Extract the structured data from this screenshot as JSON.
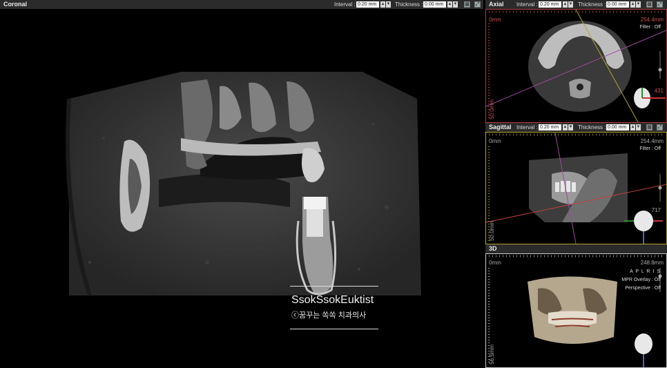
{
  "coronal": {
    "title": "Coronal",
    "interval_label": "Interval :",
    "interval_value": "0.20 mm",
    "thickness_label": "Thickness :",
    "thickness_value": "0.00 mm"
  },
  "axial": {
    "title": "Axial",
    "interval_label": "Interval :",
    "interval_value": "0.20 mm",
    "thickness_label": "Thickness :",
    "thickness_value": "0.00 mm",
    "top_left": "0mm",
    "top_right": "254.4mm",
    "bottom_left": "50.0mm",
    "filter": "Filter :  Off",
    "slice": "431"
  },
  "sagittal": {
    "title": "Sagittal",
    "interval_label": "Interval :",
    "interval_value": "0.20 mm",
    "thickness_label": "Thickness :",
    "thickness_value": "0.00 mm",
    "top_left": "0mm",
    "top_right": "254.4mm",
    "bottom_left": "50.0mm",
    "filter": "Filter :  Off",
    "slice": "717"
  },
  "three_d": {
    "title": "3D",
    "top_left": "0mm",
    "top_right": "248.8mm",
    "bottom_left": "56.5mm",
    "orientation": "A P L R I S",
    "mpr_overlay": "MPR Overlay : Off",
    "perspective": "Perspective : Off"
  },
  "watermark": {
    "title": "SsokSsokEuktist",
    "subtitle": "ⓒ꿈꾸는 쏙쏙 치과의사"
  },
  "icons": [
    "grid-icon",
    "maximize-icon",
    "spin-up-icon",
    "spin-down-icon",
    "head-orientation-icon"
  ],
  "colors": {
    "axial_border": "#b33b3b",
    "sagittal_border": "#b5a531",
    "three_d_border": "#cfcfcf",
    "background": "#000000"
  }
}
